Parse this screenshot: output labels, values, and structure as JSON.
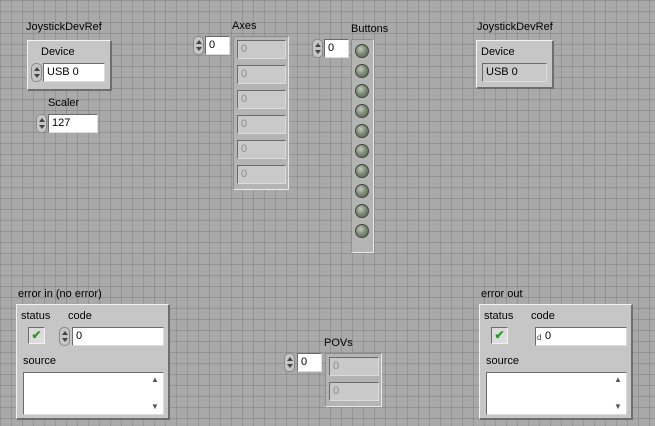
{
  "joystick_in": {
    "title": "JoystickDevRef",
    "device_label": "Device",
    "device_value": "USB 0",
    "scaler_label": "Scaler",
    "scaler_value": "127"
  },
  "joystick_out": {
    "title": "JoystickDevRef",
    "device_label": "Device",
    "device_value": "USB 0"
  },
  "axes": {
    "label": "Axes",
    "index": "0",
    "values": [
      "0",
      "0",
      "0",
      "0",
      "0",
      "0"
    ]
  },
  "buttons": {
    "label": "Buttons",
    "index": "0",
    "count": 10
  },
  "povs": {
    "label": "POVs",
    "index": "0",
    "values": [
      "0",
      "0"
    ]
  },
  "error_in": {
    "title": "error in (no error)",
    "status_label": "status",
    "code_label": "code",
    "code_value": "0",
    "source_label": "source",
    "status_check": "✔"
  },
  "error_out": {
    "title": "error out",
    "status_label": "status",
    "code_label": "code",
    "code_value": "0",
    "source_label": "source",
    "status_check": "✔"
  },
  "colors": {
    "check_green": "#2e9a2e",
    "led_off": "#7f8e78"
  }
}
